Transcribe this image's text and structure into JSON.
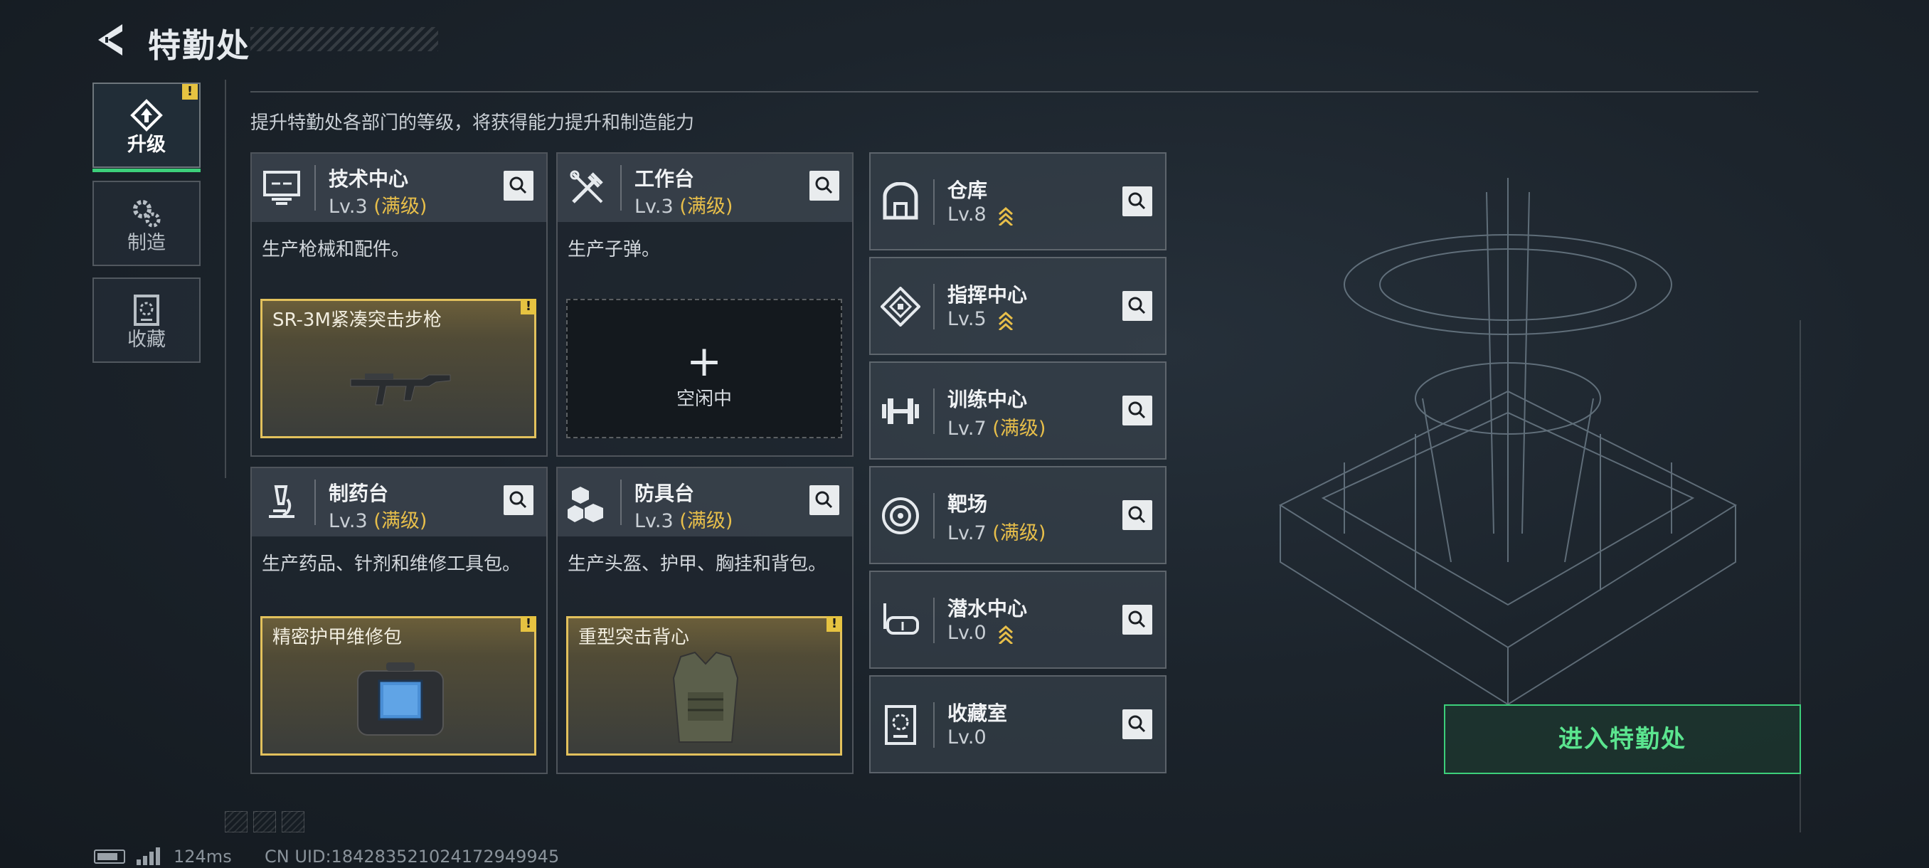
{
  "header": {
    "title": "特勤处"
  },
  "subtitle": "提升特勤处各部门的等级，将获得能力提升和制造能力",
  "tabs": [
    {
      "label": "升级",
      "icon": "upgrade-icon",
      "active": true,
      "alert": "!"
    },
    {
      "label": "制造",
      "icon": "gears-icon",
      "active": false
    },
    {
      "label": "收藏",
      "icon": "collection-icon",
      "active": false
    }
  ],
  "stations": [
    {
      "name": "技术中心",
      "level": "Lv.3",
      "max": "(满级)",
      "icon": "computer-icon",
      "desc": "生产枪械和配件。",
      "slot": {
        "type": "item",
        "title": "SR-3M紧凑突击步枪",
        "alert": "!"
      }
    },
    {
      "name": "工作台",
      "level": "Lv.3",
      "max": "(满级)",
      "icon": "tools-icon",
      "desc": "生产子弹。",
      "slot": {
        "type": "empty",
        "plus": "+",
        "status": "空闲中"
      }
    },
    {
      "name": "制药台",
      "level": "Lv.3",
      "max": "(满级)",
      "icon": "microscope-icon",
      "desc": "生产药品、针剂和维修工具包。",
      "slot": {
        "type": "item",
        "title": "精密护甲维修包",
        "alert": "!"
      }
    },
    {
      "name": "防具台",
      "level": "Lv.3",
      "max": "(满级)",
      "icon": "armor-boxes-icon",
      "desc": "生产头盔、护甲、胸挂和背包。",
      "slot": {
        "type": "item",
        "title": "重型突击背心",
        "alert": "!"
      }
    }
  ],
  "facilities": [
    {
      "name": "仓库",
      "level": "Lv.8",
      "max": "",
      "upgradable": true,
      "icon": "warehouse-icon"
    },
    {
      "name": "指挥中心",
      "level": "Lv.5",
      "max": "",
      "upgradable": true,
      "icon": "command-icon"
    },
    {
      "name": "训练中心",
      "level": "Lv.7",
      "max": "(满级)",
      "upgradable": false,
      "icon": "dumbbell-icon"
    },
    {
      "name": "靶场",
      "level": "Lv.7",
      "max": "(满级)",
      "upgradable": false,
      "icon": "target-icon"
    },
    {
      "name": "潜水中心",
      "level": "Lv.0",
      "max": "",
      "upgradable": true,
      "icon": "diving-mask-icon"
    },
    {
      "name": "收藏室",
      "level": "Lv.0",
      "max": "",
      "upgradable": false,
      "icon": "collection-room-icon"
    }
  ],
  "enter_button": "进入特勤处",
  "footer": {
    "ping": "124ms",
    "uid": "CN UID:184283521024172949945"
  },
  "colors": {
    "accent_green": "#3ccf7a",
    "max_level_gold": "#e8bf4a",
    "alert_yellow": "#e6c341"
  }
}
